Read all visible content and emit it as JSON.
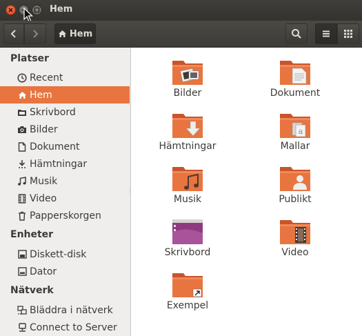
{
  "window": {
    "title": "Hem"
  },
  "toolbar": {
    "path_label": "Hem"
  },
  "sidebar": {
    "sections": [
      {
        "title": "Platser",
        "items": [
          {
            "label": "Recent",
            "icon": "clock-icon"
          },
          {
            "label": "Hem",
            "icon": "home-icon",
            "active": true
          },
          {
            "label": "Skrivbord",
            "icon": "desktop-folder-icon"
          },
          {
            "label": "Bilder",
            "icon": "camera-icon"
          },
          {
            "label": "Dokument",
            "icon": "document-icon"
          },
          {
            "label": "Hämtningar",
            "icon": "download-icon"
          },
          {
            "label": "Musik",
            "icon": "music-icon"
          },
          {
            "label": "Video",
            "icon": "film-icon"
          },
          {
            "label": "Papperskorgen",
            "icon": "trash-icon"
          }
        ]
      },
      {
        "title": "Enheter",
        "items": [
          {
            "label": "Diskett-disk",
            "icon": "floppy-icon"
          },
          {
            "label": "Dator",
            "icon": "drive-icon"
          }
        ]
      },
      {
        "title": "Nätverk",
        "items": [
          {
            "label": "Bläddra i nätverk",
            "icon": "network-icon"
          },
          {
            "label": "Connect to Server",
            "icon": "server-icon"
          }
        ]
      }
    ]
  },
  "files": [
    {
      "name": "Bilder",
      "emblem": "pictures"
    },
    {
      "name": "Dokument",
      "emblem": "documents"
    },
    {
      "name": "Hämtningar",
      "emblem": "downloads"
    },
    {
      "name": "Mallar",
      "emblem": "templates"
    },
    {
      "name": "Musik",
      "emblem": "music"
    },
    {
      "name": "Publikt",
      "emblem": "public"
    },
    {
      "name": "Skrivbord",
      "emblem": "desktop"
    },
    {
      "name": "Video",
      "emblem": "video"
    },
    {
      "name": "Exempel",
      "emblem": "link"
    }
  ],
  "colors": {
    "accent": "#e8743f",
    "folder": "#e8743f",
    "folder_dark": "#c9542a",
    "sidebar_bg": "#efeeec"
  }
}
